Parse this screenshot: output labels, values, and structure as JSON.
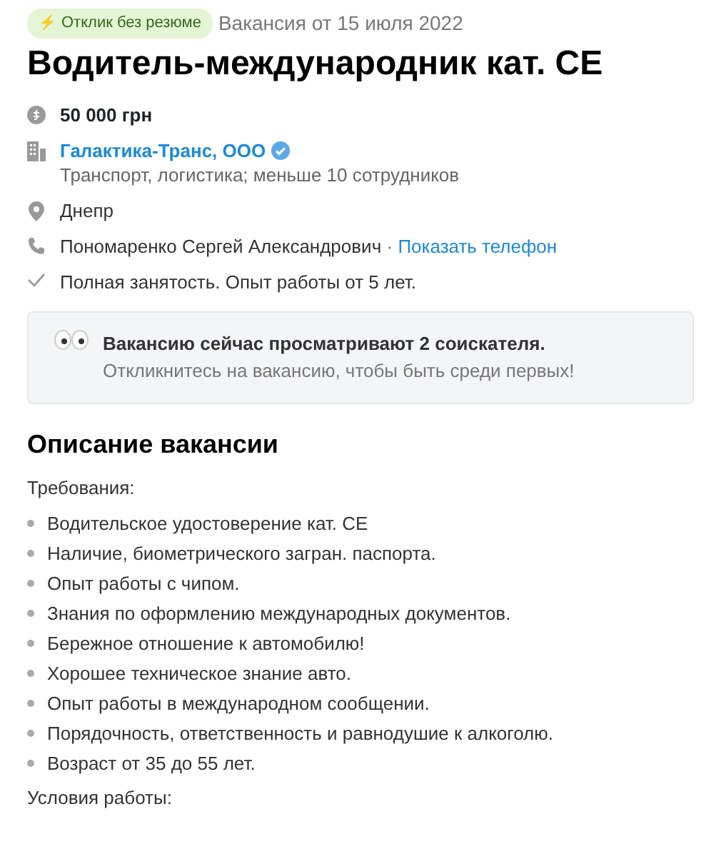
{
  "badge": {
    "icon": "⚡",
    "label": "Отклик без резюме"
  },
  "posted": "Вакансия от 15 июля 2022",
  "title": "Водитель-международник кат. CE",
  "details": [
    {
      "kind": "salary",
      "text": "50 000 грн"
    },
    {
      "kind": "company",
      "text": "Галактика-Транс, ООО",
      "verified": true,
      "sub": "Транспорт, логистика; меньше 10 сотрудников"
    },
    {
      "kind": "city",
      "text": "Днепр"
    },
    {
      "kind": "contact",
      "text": "Пономаренко Сергей Александрович",
      "separator": "·",
      "link": "Показать телефон"
    },
    {
      "kind": "employment",
      "text": "Полная занятость. Опыт работы от 5 лет."
    }
  ],
  "notice": {
    "title": "Вакансию сейчас просматривают 2 соискателя.",
    "text": "Откликнитесь на вакансию, чтобы быть среди первых!"
  },
  "description": {
    "heading": "Описание вакансии",
    "requirements_label": "Требования:",
    "requirements": [
      "Водительское удостоверение кат. CE",
      "Наличие, биометрического загран. паспорта.",
      "Опыт работы с чипом.",
      "Знания по оформлению международных документов.",
      "Бережное отношение к автомобилю!",
      "Хорошее техническое знание авто.",
      "Опыт работы в международном сообщении.",
      "Порядочность, ответственность и равнодушие к алкоголю.",
      "Возраст от 35 до 55 лет."
    ],
    "conditions_label": "Условия работы:"
  }
}
